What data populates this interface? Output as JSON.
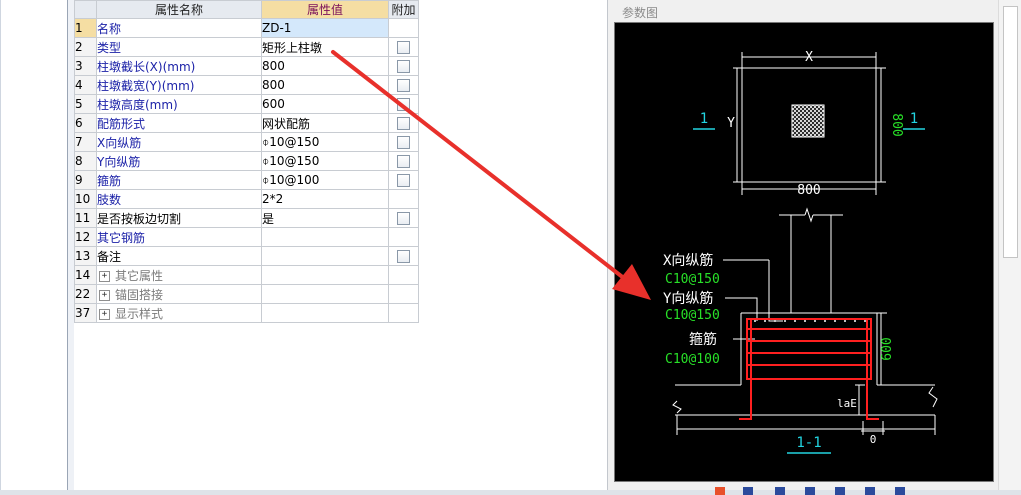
{
  "grid": {
    "headers": {
      "name": "属性名称",
      "value": "属性值",
      "extra": "附加"
    },
    "rows": [
      {
        "num": "1",
        "name": "名称",
        "value": "ZD-1"
      },
      {
        "num": "2",
        "name": "类型",
        "value": "矩形上柱墩"
      },
      {
        "num": "3",
        "name": "柱墩截长(X)(mm)",
        "value": "800"
      },
      {
        "num": "4",
        "name": "柱墩截宽(Y)(mm)",
        "value": "800"
      },
      {
        "num": "5",
        "name": "柱墩高度(mm)",
        "value": "600"
      },
      {
        "num": "6",
        "name": "配筋形式",
        "value": "网状配筋"
      },
      {
        "num": "7",
        "name": "X向纵筋",
        "value": "⌽10@150"
      },
      {
        "num": "8",
        "name": "Y向纵筋",
        "value": "⌽10@150"
      },
      {
        "num": "9",
        "name": "箍筋",
        "value": "⌽10@100"
      },
      {
        "num": "10",
        "name": "肢数",
        "value": "2*2"
      },
      {
        "num": "11",
        "name": "是否按板边切割",
        "value": "是"
      },
      {
        "num": "12",
        "name": "其它钢筋",
        "value": ""
      },
      {
        "num": "13",
        "name": "备注",
        "value": ""
      },
      {
        "num": "14",
        "name": "其它属性",
        "value": ""
      },
      {
        "num": "22",
        "name": "锚固搭接",
        "value": ""
      },
      {
        "num": "37",
        "name": "显示样式",
        "value": ""
      }
    ],
    "expand_symbol": "+"
  },
  "diagram": {
    "panel_title": "参数图",
    "plan": {
      "x_label": "X",
      "y_label": "Y",
      "width_dim": "800",
      "height_dim": "800",
      "section_mark": "1"
    },
    "section": {
      "x_bar_label": "X向纵筋",
      "x_bar_spec": "C10@150",
      "y_bar_label": "Y向纵筋",
      "y_bar_spec": "C10@150",
      "stirrup_label": "箍筋",
      "stirrup_spec": "C10@100",
      "height_dim": "600",
      "lae_label": "laE",
      "zero_label": "0",
      "title": "1-1"
    },
    "colors": {
      "canvas": "#000000",
      "lines": "#ffffff",
      "dims": "#28e028",
      "section_mark": "#22d4e0",
      "rebar": "#ff2020",
      "arrow": "#e8302b"
    }
  }
}
